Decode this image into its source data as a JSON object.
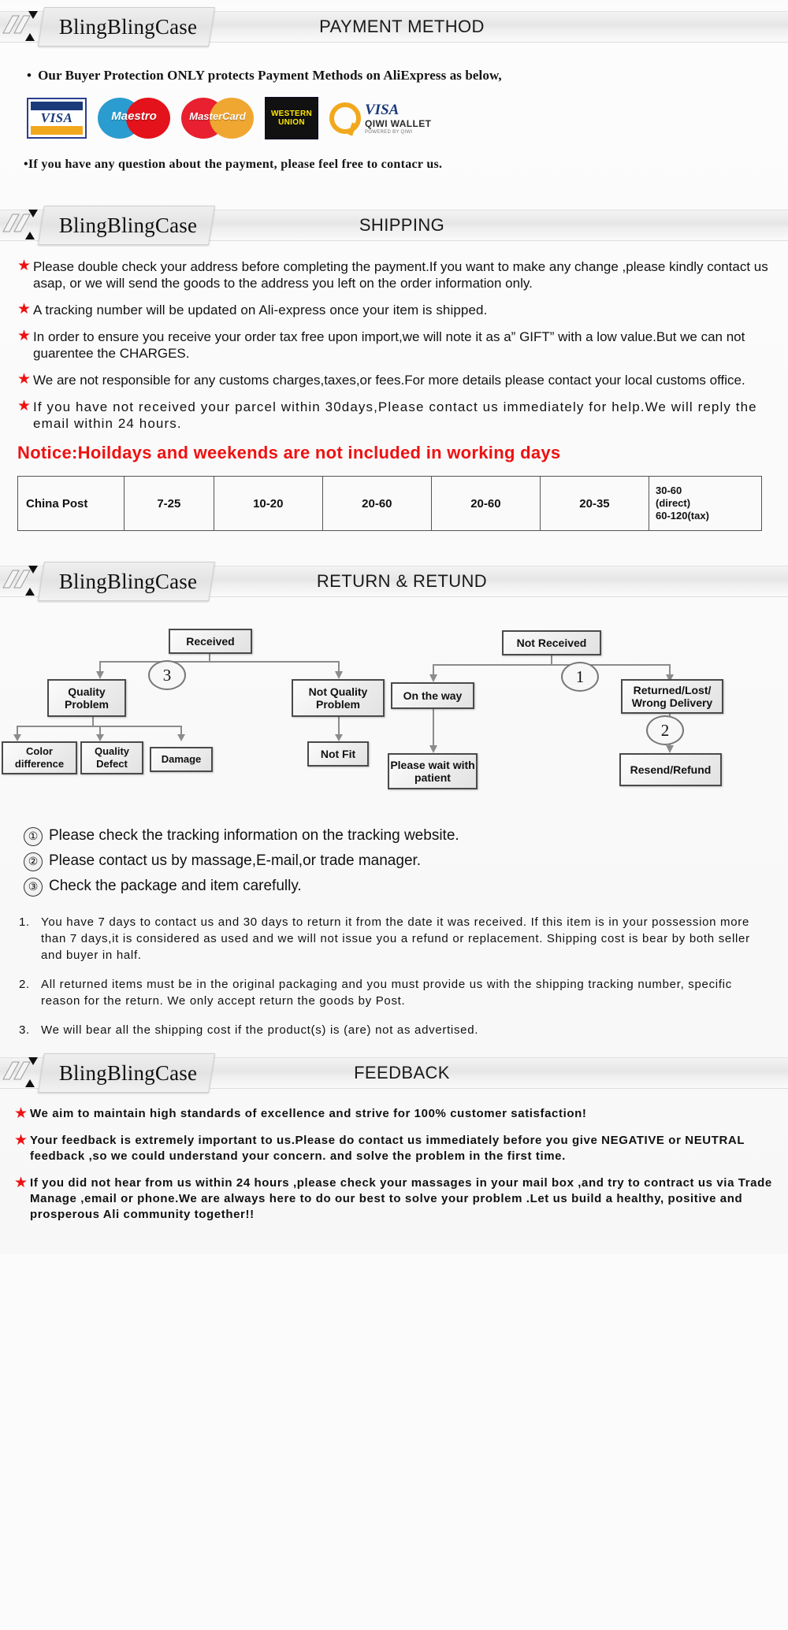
{
  "brand": "BlingBlingCase",
  "sections": {
    "payment": {
      "title": "PAYMENT METHOD",
      "bullet1": "Our Buyer Protection ONLY protects Payment Methods on AliExpress as below,",
      "bullet2": "If you have any question about the payment, please feel free to contacr us.",
      "bullet_dot": "•",
      "logos": [
        {
          "name": "visa-logo",
          "label": "VISA"
        },
        {
          "name": "maestro-logo",
          "label": "Maestro"
        },
        {
          "name": "mastercard-logo",
          "label": "MasterCard"
        },
        {
          "name": "western-union-logo",
          "line1": "WESTERN",
          "line2": "UNION"
        },
        {
          "name": "qiwi-visa-wallet-logo",
          "visa": "VISA",
          "wallet": "QIWI WALLET",
          "powered": "POWERED BY QIWI"
        }
      ]
    },
    "shipping": {
      "title": "SHIPPING",
      "bullets": [
        "Please double check your address before completing the payment.If you want to make any change ,please kindly contact us asap, or we will send the goods to the address you left on the order information only.",
        "A tracking number will be updated on Ali-express once your item is shipped.",
        "In order to ensure you receive your order tax free upon import,we will note it as a” GIFT” with a low value.But we can not guarentee the CHARGES.",
        "We are not responsible for any customs charges,taxes,or fees.For more details please contact your local customs office.",
        "If you have not received your parcel within 30days,Please contact us immediately for help.We will reply the email within 24 hours."
      ],
      "notice": "Notice:Hoildays and weekends are not included in working days",
      "table_row": [
        "China Post",
        "7-25",
        "10-20",
        "20-60",
        "20-60",
        "20-35"
      ],
      "table_last_cell": "30-60 (direct) 60-120(tax)",
      "table_last_lines": [
        "30-60",
        "(direct)",
        "60-120(tax)"
      ]
    },
    "return": {
      "title": "RETURN & RETUND",
      "flow": {
        "received": "Received",
        "quality_problem": "Quality Problem",
        "not_quality_problem": "Not Quality Problem",
        "color_difference": "Color difference",
        "quality_defect": "Quality Defect",
        "damage": "Damage",
        "not_fit": "Not Fit",
        "not_received": "Not  Received",
        "on_the_way": "On the way",
        "please_wait": "Please wait with patient",
        "returned_lost": "Returned/Lost/ Wrong Delivery",
        "resend_refund": "Resend/Refund",
        "marker_1": "1",
        "marker_2": "2",
        "marker_3": "3"
      },
      "numbered": [
        {
          "n": "①",
          "text": "Please check the tracking information on the tracking website."
        },
        {
          "n": "②",
          "text": "Please contact us by  massage,E-mail,or trade manager."
        },
        {
          "n": "③",
          "text": "Check the package and item carefully."
        }
      ],
      "policy": [
        {
          "n": "1.",
          "text": "You have 7 days to contact us and 30 days to return it from the date it was received. If this item is in your possession more than 7 days,it is considered as used and we will not issue you a refund or replacement. Shipping cost is bear by both seller and buyer in half."
        },
        {
          "n": "2.",
          "text": "All returned items must be in the original packaging and you must provide us with the shipping tracking number, specific reason for the return. We only accept return the goods by Post."
        },
        {
          "n": "3.",
          "text": "We will bear all the shipping cost if the product(s) is (are) not as advertised."
        }
      ]
    },
    "feedback": {
      "title": "FEEDBACK",
      "bullets": [
        "We aim to maintain high standards of excellence and strive  for 100% customer satisfaction!",
        "Your feedback is extremely important to us.Please do contact us immediately before you give NEGATIVE or NEUTRAL feedback ,so  we could understand your concern. and solve the problem in the first time.",
        "If you did not hear from us within 24 hours ,please check your massages in your mail box ,and try to contract us via Trade Manage ,email or phone.We are always here to do our best to solve your problem .Let us build a healthy, positive and prosperous Ali community together!!"
      ]
    }
  },
  "colors": {
    "star_red": "#ee1111",
    "notice_red": "#ee1111",
    "banner_gray": "#e6e6e6",
    "visa_blue": "#1a3a7a",
    "visa_gold": "#f2a81d"
  },
  "star_glyph": "★"
}
